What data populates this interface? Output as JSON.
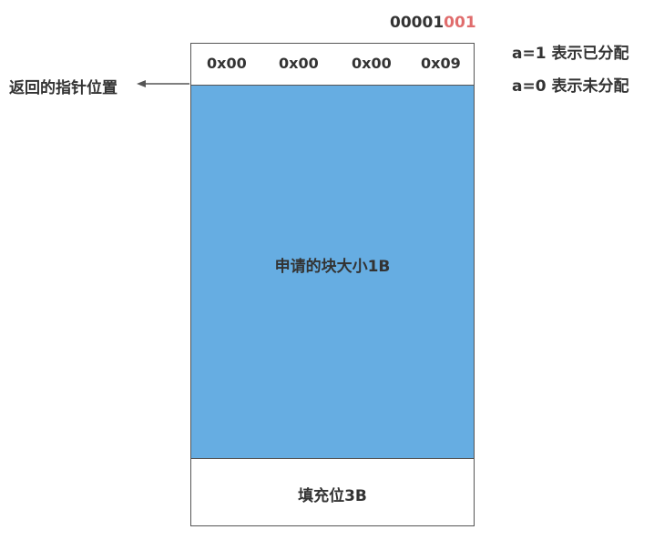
{
  "header_binary": {
    "prefix": "00001",
    "highlight": "001",
    "highlight_color": "#e06c6c"
  },
  "legend": {
    "allocated": "a=1 表示已分配",
    "free": "a=0 表示未分配"
  },
  "pointer_label": "返回的指针位置",
  "header_bytes": [
    "0x00",
    "0x00",
    "0x00",
    "0x09"
  ],
  "payload_label": "申请的块大小1B",
  "padding_label": "填充位3B",
  "colors": {
    "payload_fill": "#66ade2",
    "border": "#555555",
    "text": "#333333"
  }
}
